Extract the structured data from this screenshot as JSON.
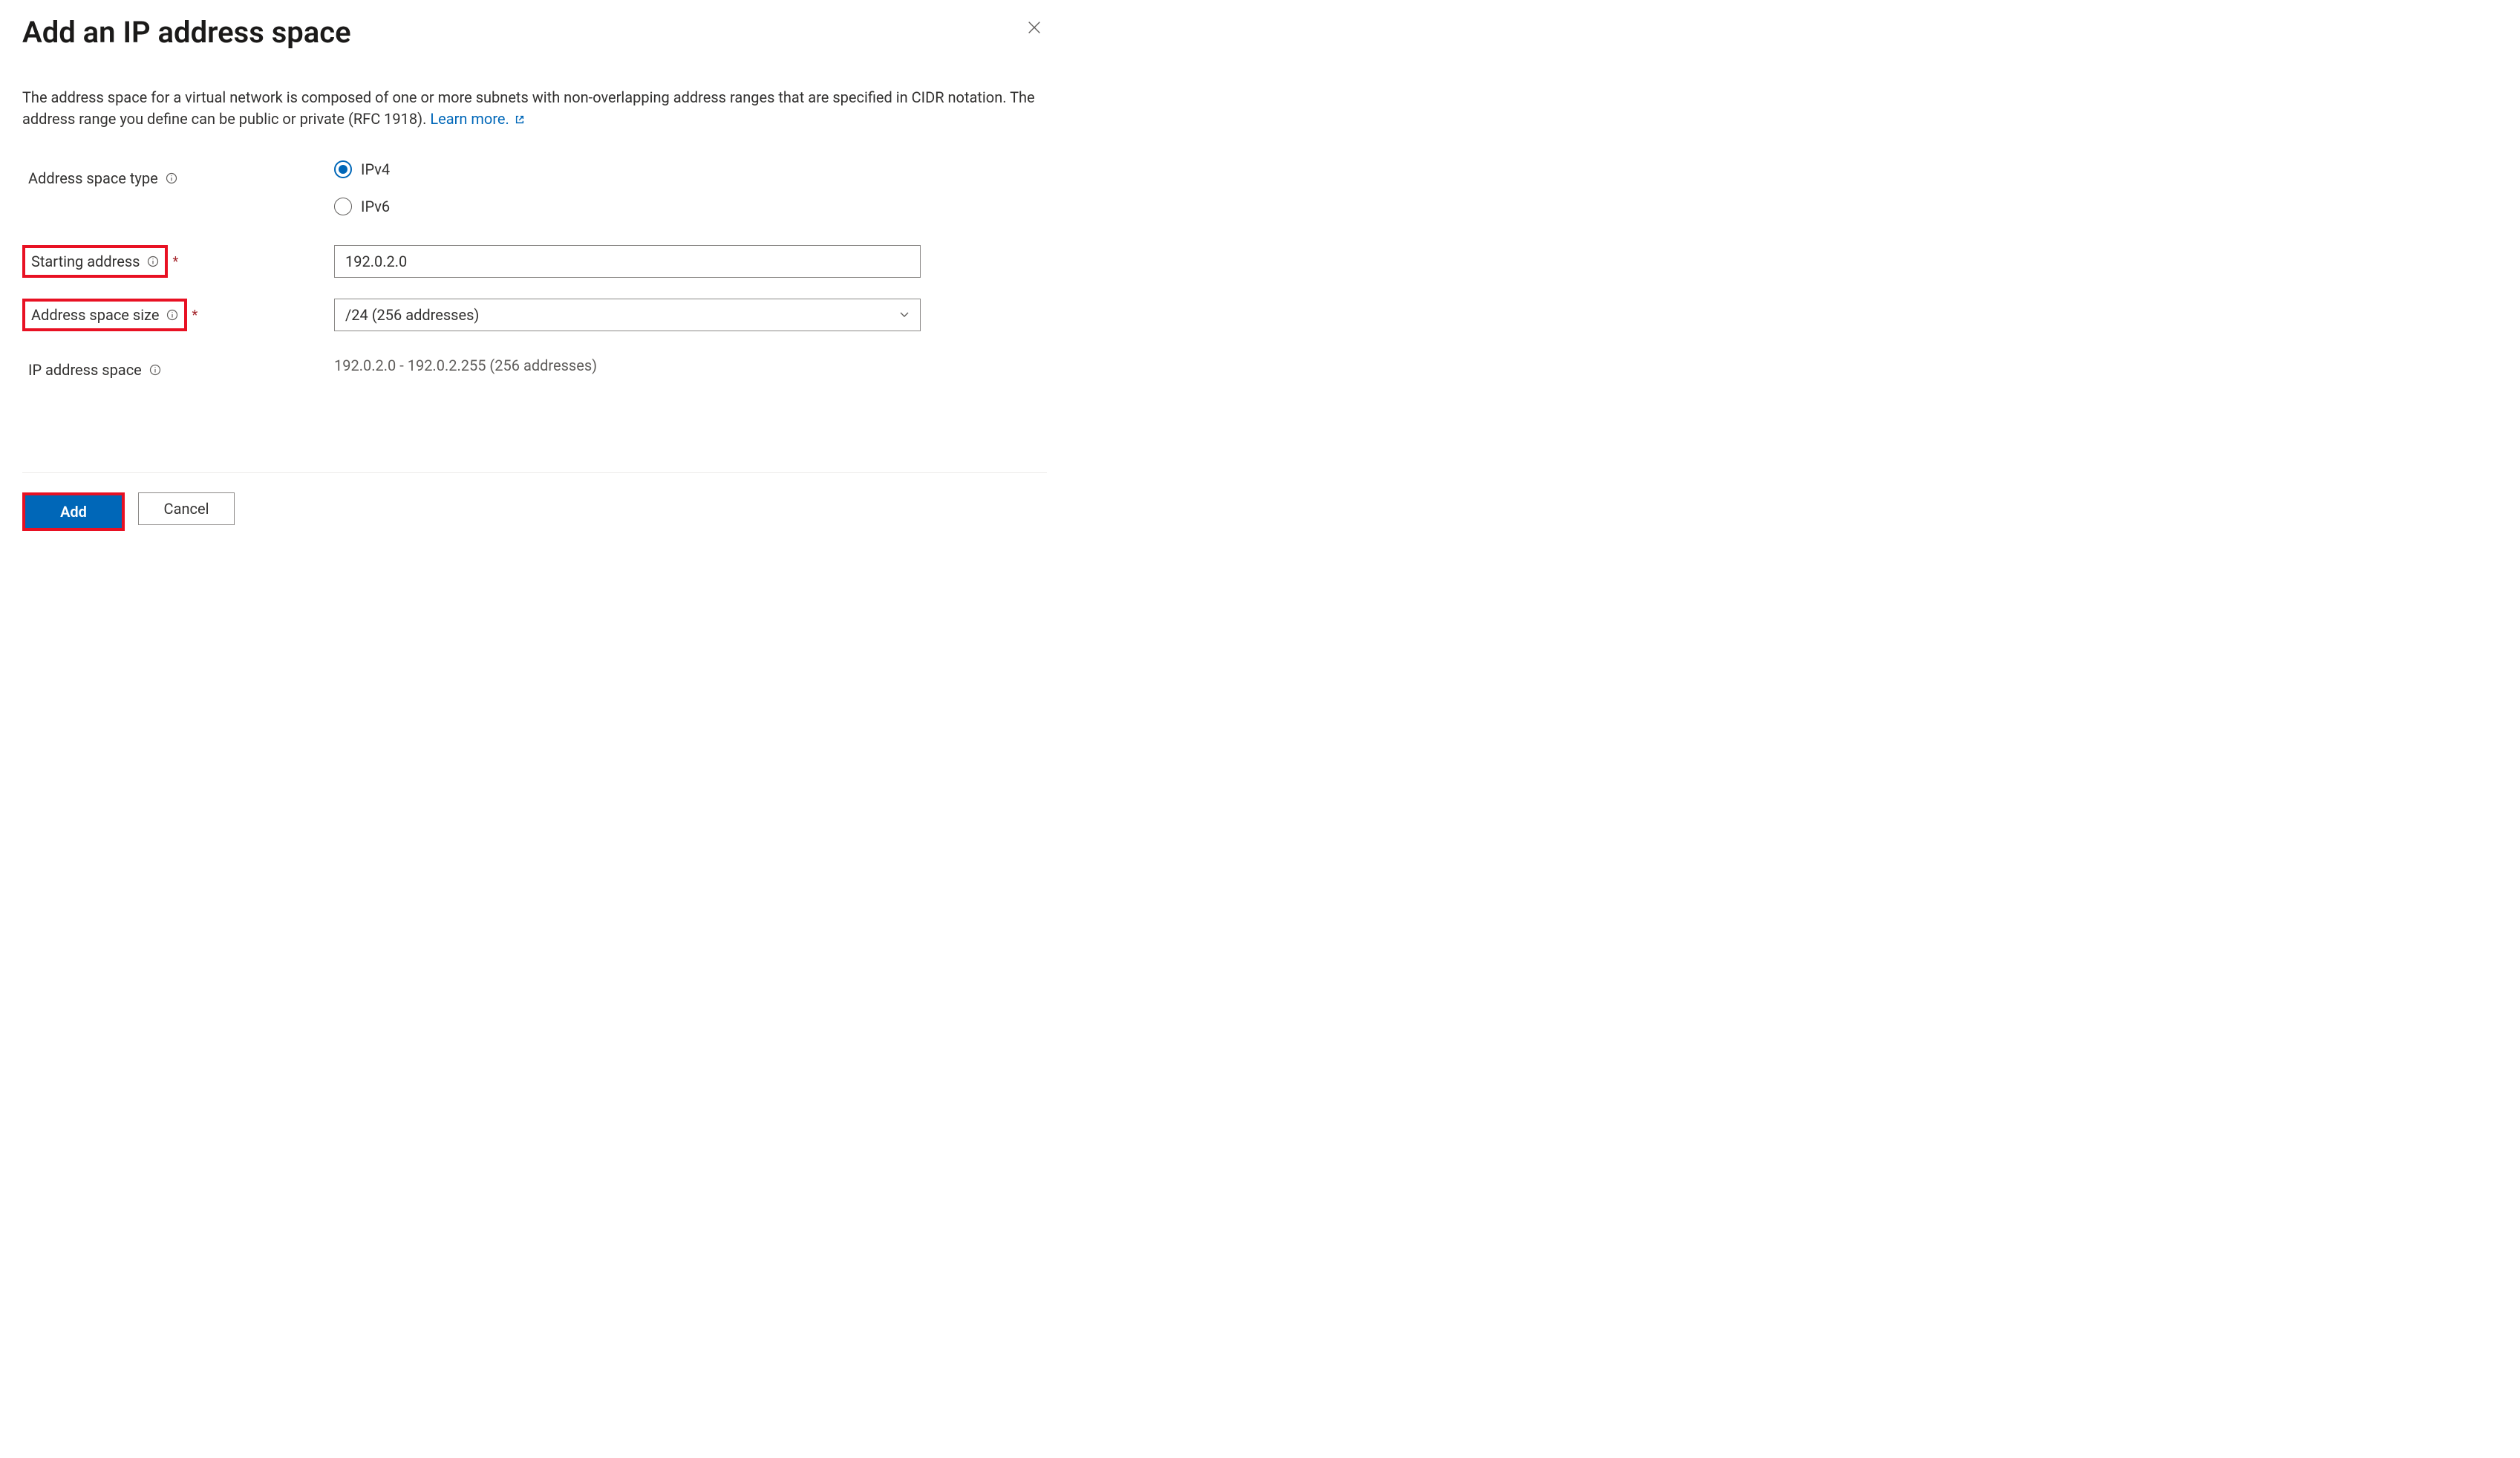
{
  "header": {
    "title": "Add an IP address space"
  },
  "description": {
    "text_part1": "The address space for a virtual network is composed of one or more subnets with non-overlapping address ranges that are specified in CIDR notation. The address range you define can be public or private (RFC 1918). ",
    "link_text": "Learn more."
  },
  "form": {
    "address_space_type": {
      "label": "Address space type",
      "options": {
        "ipv4": "IPv4",
        "ipv6": "IPv6"
      },
      "selected": "ipv4"
    },
    "starting_address": {
      "label": "Starting address",
      "required": "*",
      "value": "192.0.2.0"
    },
    "address_space_size": {
      "label": "Address space size",
      "required": "*",
      "value": "/24 (256 addresses)"
    },
    "ip_address_space": {
      "label": "IP address space",
      "value": "192.0.2.0 - 192.0.2.255 (256 addresses)"
    }
  },
  "footer": {
    "add_label": "Add",
    "cancel_label": "Cancel"
  }
}
